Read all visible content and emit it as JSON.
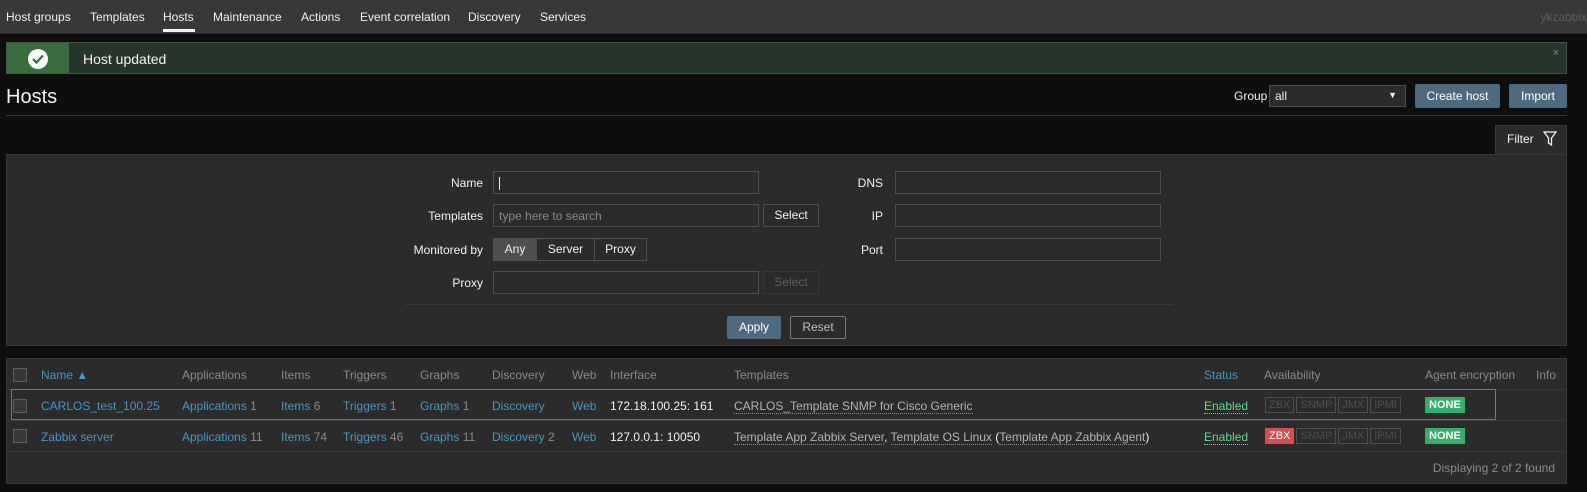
{
  "nav": {
    "items": [
      "Host groups",
      "Templates",
      "Hosts",
      "Maintenance",
      "Actions",
      "Event correlation",
      "Discovery",
      "Services"
    ],
    "user": "ykzabbix"
  },
  "message": {
    "text": "Host updated",
    "close": "×"
  },
  "header": {
    "title": "Hosts",
    "group_label": "Group",
    "group_value": "all",
    "create_label": "Create host",
    "import_label": "Import"
  },
  "filter": {
    "tab_label": "Filter",
    "name_label": "Name",
    "templates_label": "Templates",
    "templates_placeholder": "type here to search",
    "select_label": "Select",
    "monitored_label": "Monitored by",
    "monitored_options": [
      "Any",
      "Server",
      "Proxy"
    ],
    "monitored_selected": "Any",
    "proxy_label": "Proxy",
    "dns_label": "DNS",
    "ip_label": "IP",
    "port_label": "Port",
    "apply_label": "Apply",
    "reset_label": "Reset"
  },
  "table": {
    "columns": [
      "Name ▲",
      "Applications",
      "Items",
      "Triggers",
      "Graphs",
      "Discovery",
      "Web",
      "Interface",
      "Templates",
      "Status",
      "Availability",
      "Agent encryption",
      "Info"
    ],
    "rows": [
      {
        "name": "CARLOS_test_100.25",
        "applications": "Applications",
        "applications_count": "1",
        "items": "Items",
        "items_count": "6",
        "triggers": "Triggers",
        "triggers_count": "1",
        "graphs": "Graphs",
        "graphs_count": "1",
        "discovery": "Discovery",
        "discovery_count": "",
        "web": "Web",
        "interface": "172.18.100.25: 161",
        "template_1": "CARLOS_Template SNMP for Cisco Generic",
        "status": "Enabled",
        "encryption": "NONE"
      },
      {
        "name": "Zabbix server",
        "applications": "Applications",
        "applications_count": "11",
        "items": "Items",
        "items_count": "74",
        "triggers": "Triggers",
        "triggers_count": "46",
        "graphs": "Graphs",
        "graphs_count": "11",
        "discovery": "Discovery",
        "discovery_count": "2",
        "web": "Web",
        "interface": "127.0.0.1: 10050",
        "template_1": "Template App Zabbix Server",
        "template_sep": ", ",
        "template_2": "Template OS Linux",
        "template_open": " (",
        "template_3": "Template App Zabbix Agent",
        "template_close": ")",
        "status": "Enabled",
        "encryption": "NONE"
      }
    ],
    "availability": [
      "ZBX",
      "SNMP",
      "JMX",
      "IPMI"
    ],
    "footer": "Displaying 2 of 2 found"
  },
  "colors": {
    "accent": "#4796c4",
    "enabled": "#59db8f",
    "zbx_down": "#d64e4e",
    "encryption": "#34af67"
  }
}
